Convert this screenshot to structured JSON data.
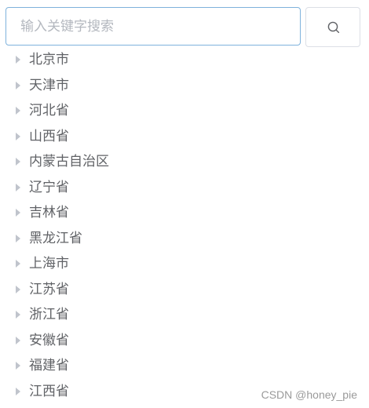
{
  "search": {
    "placeholder": "输入关键字搜索",
    "value": "",
    "button_icon": "search-icon"
  },
  "tree": {
    "nodes": [
      {
        "label": "北京市",
        "icon": "caret-right-icon"
      },
      {
        "label": "天津市",
        "icon": "caret-right-icon"
      },
      {
        "label": "河北省",
        "icon": "caret-right-icon"
      },
      {
        "label": "山西省",
        "icon": "caret-right-icon"
      },
      {
        "label": "内蒙古自治区",
        "icon": "caret-right-icon"
      },
      {
        "label": "辽宁省",
        "icon": "caret-right-icon"
      },
      {
        "label": "吉林省",
        "icon": "caret-right-icon"
      },
      {
        "label": "黑龙江省",
        "icon": "caret-right-icon"
      },
      {
        "label": "上海市",
        "icon": "caret-right-icon"
      },
      {
        "label": "江苏省",
        "icon": "caret-right-icon"
      },
      {
        "label": "浙江省",
        "icon": "caret-right-icon"
      },
      {
        "label": "安徽省",
        "icon": "caret-right-icon"
      },
      {
        "label": "福建省",
        "icon": "caret-right-icon"
      },
      {
        "label": "江西省",
        "icon": "caret-right-icon"
      }
    ]
  },
  "watermark": "CSDN @honey_pie",
  "colors": {
    "input_border_focus": "#7fb2dc",
    "button_border": "#dcdfe6",
    "text": "#606266",
    "placeholder": "#b4b8bf",
    "caret": "#c0c4cc"
  }
}
